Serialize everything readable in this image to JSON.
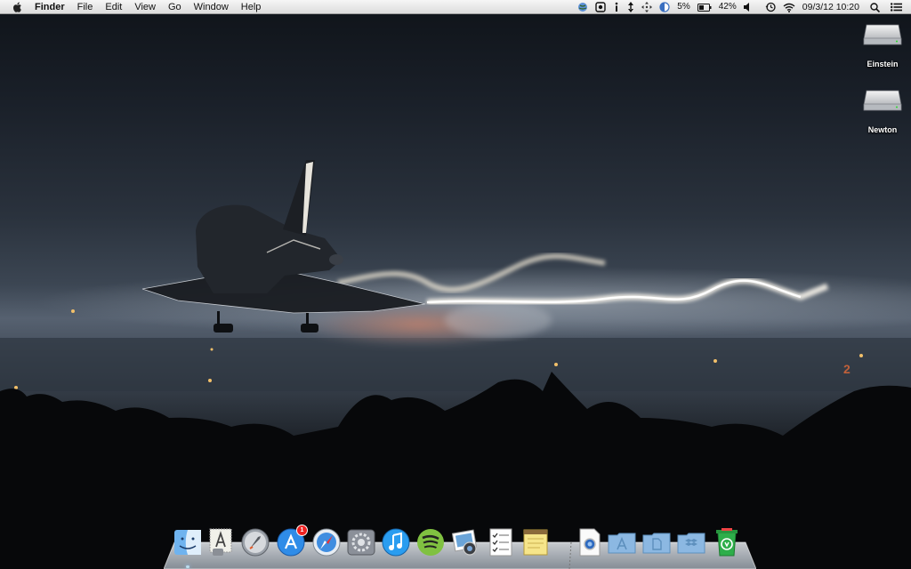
{
  "menubar": {
    "apple_icon": "apple-logo",
    "app_name": "Finder",
    "menus": [
      "File",
      "Edit",
      "View",
      "Go",
      "Window",
      "Help"
    ],
    "status": {
      "battery_percent_small": "5%",
      "battery_percent": "42%",
      "datetime": "09/3/12 10:20"
    }
  },
  "desktop": {
    "drives": [
      {
        "label": "Einstein",
        "icon": "hard-drive-icon"
      },
      {
        "label": "Newton",
        "icon": "hard-drive-icon"
      }
    ]
  },
  "dock": {
    "items": [
      {
        "name": "Finder",
        "icon": "finder-icon",
        "running": true
      },
      {
        "name": "Script Editor",
        "icon": "stamp-app-icon"
      },
      {
        "name": "Launchpad",
        "icon": "launchpad-icon"
      },
      {
        "name": "App Store",
        "icon": "app-store-icon",
        "badge": "1"
      },
      {
        "name": "Safari",
        "icon": "safari-icon"
      },
      {
        "name": "System Preferences",
        "icon": "system-preferences-icon"
      },
      {
        "name": "iTunes",
        "icon": "itunes-icon"
      },
      {
        "name": "Spotify",
        "icon": "spotify-icon"
      },
      {
        "name": "iPhoto",
        "icon": "iphoto-icon"
      },
      {
        "name": "Reminders",
        "icon": "reminders-icon"
      },
      {
        "name": "Notes",
        "icon": "notes-icon"
      },
      {
        "name": "Preview",
        "icon": "preview-document-icon"
      },
      {
        "name": "Applications",
        "icon": "applications-folder-icon"
      },
      {
        "name": "Documents",
        "icon": "documents-folder-icon"
      },
      {
        "name": "Dropbox",
        "icon": "dropbox-folder-icon"
      },
      {
        "name": "Trash",
        "icon": "recycle-bin-icon"
      }
    ]
  },
  "wallpaper": {
    "runway_marker": "2",
    "sky_color": "#1a2029",
    "trail_color": "#f3ead8"
  }
}
